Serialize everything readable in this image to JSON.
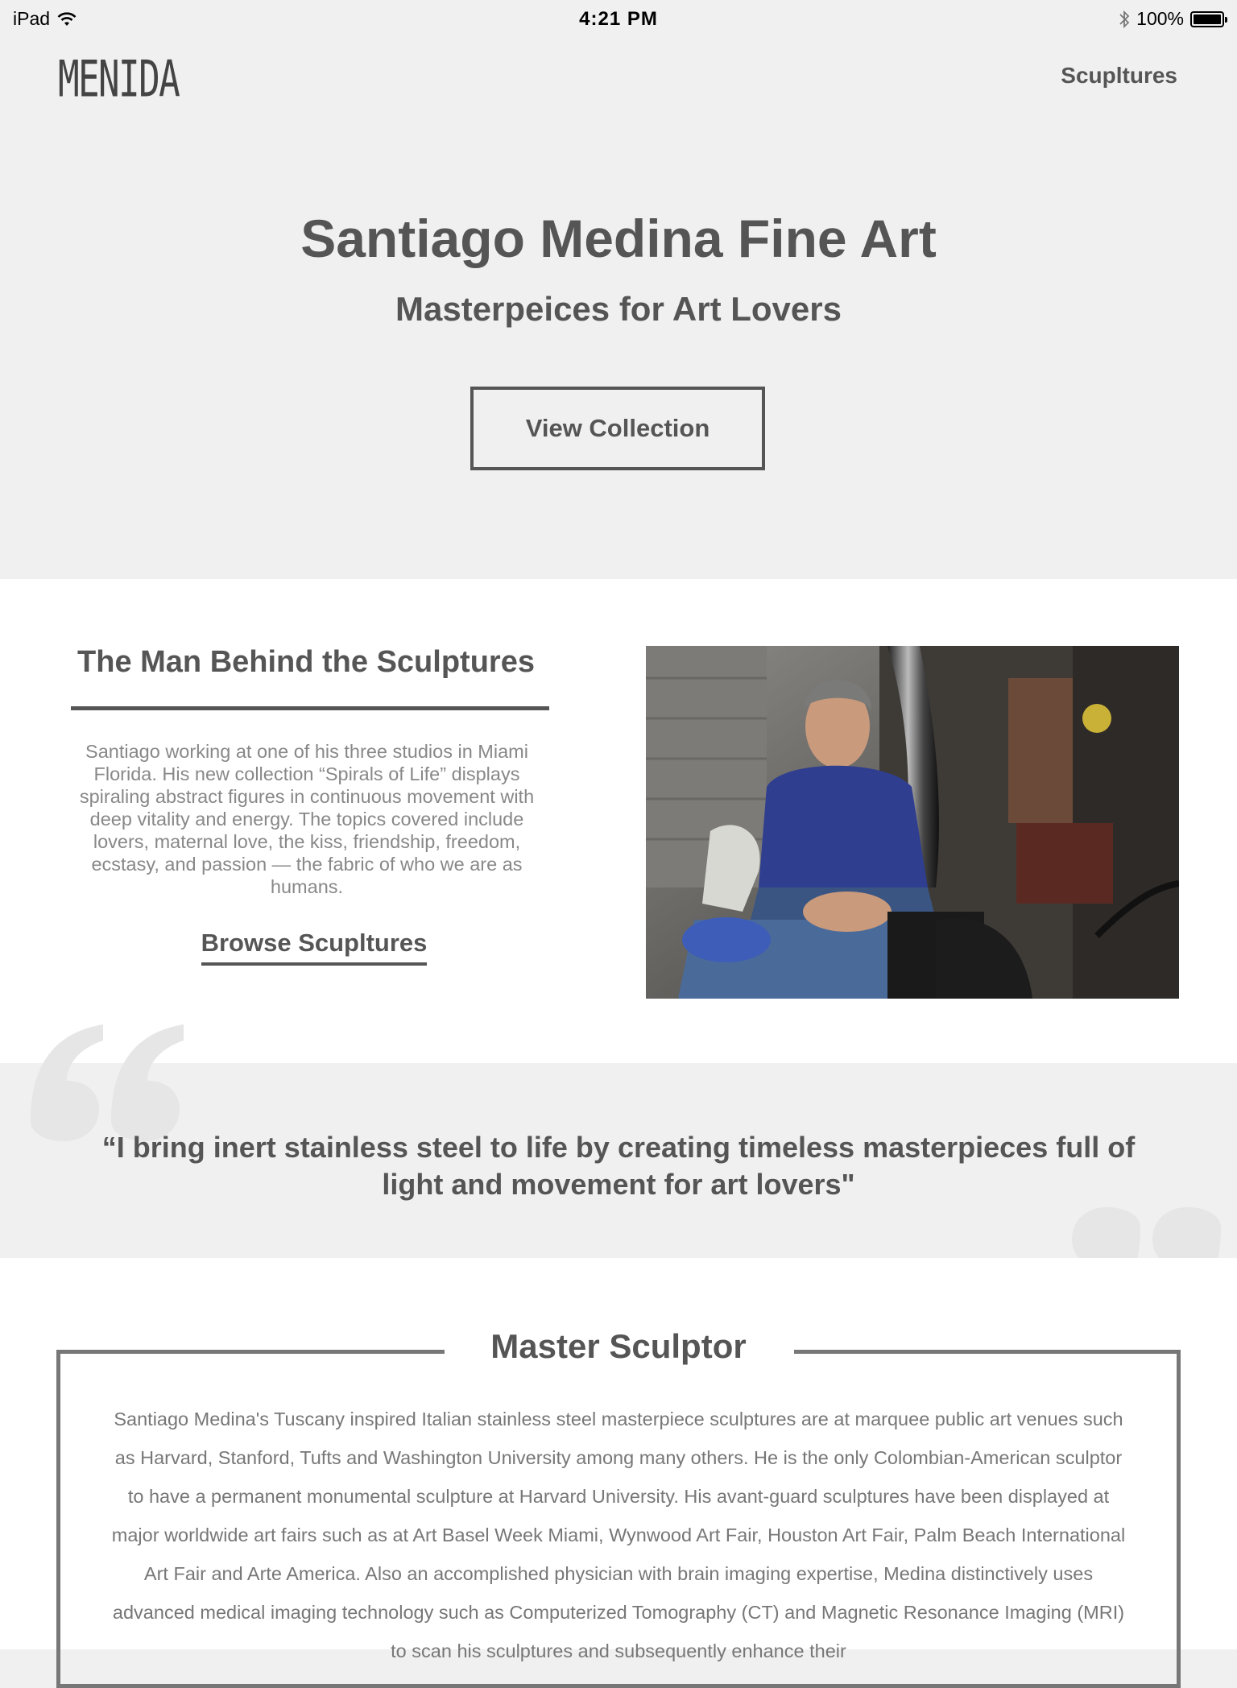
{
  "status_bar": {
    "device": "iPad",
    "time": "4:21 PM",
    "battery": "100%"
  },
  "header": {
    "logo": "MENIDA",
    "nav_link": "Scupltures"
  },
  "hero": {
    "title": "Santiago Medina Fine Art",
    "subtitle": "Masterpeices for Art Lovers",
    "button": "View Collection"
  },
  "about": {
    "title": "The Man Behind the Sculptures",
    "text": "Santiago working at one of his three studios in Miami Florida. His new collection “Spirals of Life” displays spiraling abstract figures in continuous movement with deep vitality and energy. The topics covered include lovers, maternal love, the kiss, friendship, freedom, ecstasy, and passion — the fabric of who we are as humans.",
    "link": "Browse Scupltures"
  },
  "quote": {
    "text": "“I bring inert stainless steel to life by creating timeless masterpieces full of light and movement for art lovers\""
  },
  "master": {
    "title": "Master Sculptor",
    "text": "Santiago Medina's Tuscany inspired Italian stainless steel masterpiece sculptures are at marquee public art venues such as Harvard, Stanford, Tufts and Washington University among many others. He is the only Colombian-American sculptor to have a permanent monumental sculpture at Harvard University. His avant-guard sculptures have been displayed at major worldwide art fairs such as at Art Basel Week Miami, Wynwood Art Fair, Houston Art Fair, Palm Beach International Art Fair and Arte America. Also an accomplished physician with brain imaging expertise, Medina distinctively uses advanced medical imaging technology such as Computerized Tomography (CT) and Magnetic Resonance Imaging (MRI) to scan his sculptures and subsequently enhance their"
  },
  "colors": {
    "page_bg": "#f0f0f0",
    "text_dark": "#555555",
    "text_muted": "#888888",
    "shirt": "#2f3e8f"
  }
}
